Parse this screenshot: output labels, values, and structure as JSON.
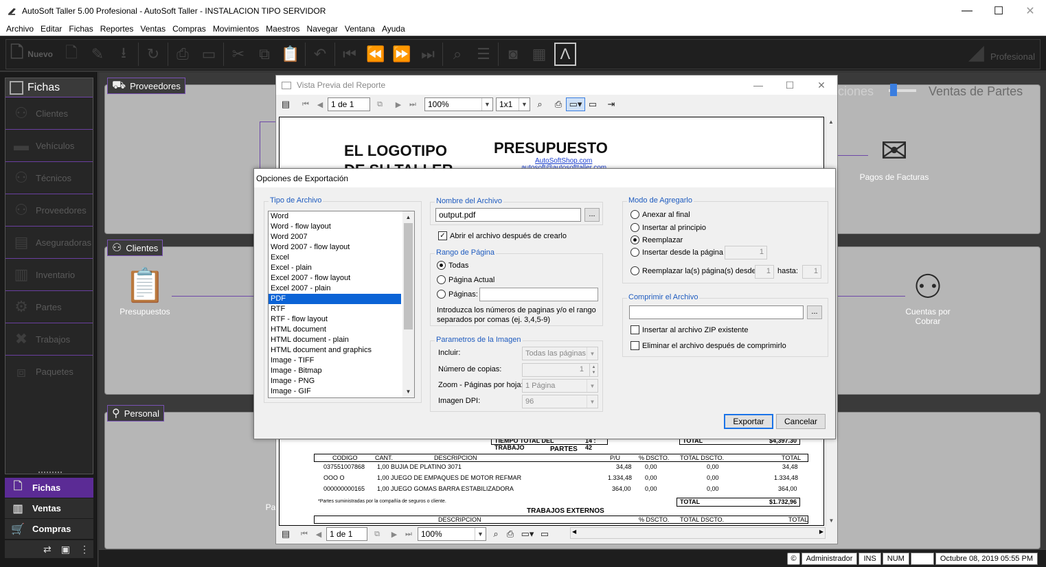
{
  "window": {
    "title": "AutoSoft Taller 5.00 Profesional - AutoSoft Taller - INSTALACION TIPO SERVIDOR",
    "minimize": "—",
    "maximize": "☐",
    "close": "✕"
  },
  "menu": [
    "Archivo",
    "Editar",
    "Fichas",
    "Reportes",
    "Ventas",
    "Compras",
    "Movimientos",
    "Maestros",
    "Navegar",
    "Ventana",
    "Ayuda"
  ],
  "toolbar": {
    "new_label": "Nuevo",
    "brand": "Profesional"
  },
  "sidebar": {
    "header": "Fichas",
    "items": [
      {
        "label": "Clientes",
        "icon": "people-icon"
      },
      {
        "label": "Vehículos",
        "icon": "car-icon"
      },
      {
        "label": "Técnicos",
        "icon": "people-icon"
      },
      {
        "label": "Proveedores",
        "icon": "people-icon"
      },
      {
        "label": "Aseguradoras",
        "icon": "id-card-icon"
      },
      {
        "label": "Inventario",
        "icon": "inventory-icon"
      },
      {
        "label": "Partes",
        "icon": "engine-icon"
      },
      {
        "label": "Trabajos",
        "icon": "tools-icon"
      },
      {
        "label": "Paquetes",
        "icon": "package-icon"
      }
    ],
    "nav": [
      {
        "label": "Fichas"
      },
      {
        "label": "Ventas"
      },
      {
        "label": "Compras"
      }
    ]
  },
  "workspace": {
    "sections": {
      "proveedores": "Proveedores",
      "clientes": "Clientes",
      "personal": "Personal"
    },
    "heading_left": "ciones",
    "heading_right": "Ventas de Partes",
    "modules": {
      "pagos": "Pagos de Facturas",
      "presupuestos": "Presupuestos",
      "cuentas": "Cuentas por Cobrar",
      "pa": "Pa"
    }
  },
  "preview": {
    "title": "Vista Previa del Reporte",
    "page_field": "1 de 1",
    "zoom": "100%",
    "layout": "1x1",
    "report": {
      "logo_line1": "EL LOGOTIPO",
      "logo_line2": "DE SU TALLER",
      "title": "PRESUPUESTO",
      "link1": "AutoSoftShop.com",
      "link2": "autosoft@autosofttaller.com",
      "tiempo_label": "TIEMPO TOTAL DEL TRABAJO",
      "tiempo_value": "14 : 42",
      "total_label": "TOTAL",
      "total_value": "$4,397.30",
      "partes_title": "PARTES",
      "columns": [
        "CODIGO",
        "CANT.",
        "DESCRIPCION",
        "P/U",
        "% DSCTO.",
        "TOTAL DSCTO.",
        "TOTAL"
      ],
      "rows": [
        {
          "codigo": "037551007868",
          "cant": "1,00",
          "desc": "BUJIA DE PLATINO 3071",
          "pu": "34,48",
          "dscto": "0,00",
          "tdscto": "0,00",
          "total": "34,48"
        },
        {
          "codigo": "OOO O",
          "cant": "1,00",
          "desc": "JUEGO DE EMPAQUES DE MOTOR REFMAR",
          "pu": "1.334,48",
          "dscto": "0,00",
          "tdscto": "0,00",
          "total": "1.334,48"
        },
        {
          "codigo": "000000000165",
          "cant": "1,00",
          "desc": "JUEGO GOMAS BARRA ESTABILIZADORA",
          "pu": "364,00",
          "dscto": "0,00",
          "tdscto": "0,00",
          "total": "364,00"
        }
      ],
      "parts_total_label": "TOTAL",
      "parts_total_value": "$1.732,96",
      "nota": "*Partes suministradas por la compañía de seguros o cliente.",
      "externos_title": "TRABAJOS EXTERNOS",
      "ext_columns": [
        "DESCRIPCION",
        "% DSCTO.",
        "TOTAL DSCTO.",
        "TOTAL"
      ]
    }
  },
  "dialog": {
    "title": "Opciones de Exportación",
    "tipo_label": "Tipo de Archivo",
    "file_types": [
      "Word",
      "Word - flow layout",
      "Word 2007",
      "Word 2007 - flow layout",
      "Excel",
      "Excel - plain",
      "Excel 2007 - flow layout",
      "Excel 2007 - plain",
      "PDF",
      "RTF",
      "RTF - flow layout",
      "HTML document",
      "HTML document - plain",
      "HTML document and graphics",
      "Image - TIFF",
      "Image - Bitmap",
      "Image - PNG",
      "Image - GIF"
    ],
    "selected_type": "PDF",
    "nombre_label": "Nombre del Archivo",
    "filename": "output.pdf",
    "browse": "...",
    "abrir_label": "Abrir el archivo después de crearlo",
    "rango_label": "Rango de Página",
    "todas": "Todas",
    "actual": "Página Actual",
    "paginas": "Páginas:",
    "help": "Introduzca los números de paginas y/o el rango separados por comas (ej. 3,4,5-9)",
    "imagen_label": "Parametros de la Imagen",
    "incluir_label": "Incluir:",
    "incluir_value": "Todas las páginas",
    "copias_label": "Número de copias:",
    "copias_value": "1",
    "zoom_label": "Zoom - Páginas por hoja:",
    "zoom_value": "1 Página",
    "dpi_label": "Imagen DPI:",
    "dpi_value": "96",
    "modo_label": "Modo de Agregarlo",
    "anexar": "Anexar al final",
    "insertar": "Insertar al principio",
    "reemplazar": "Reemplazar",
    "insertar_desde": "Insertar desde la página",
    "insertar_desde_value": "1",
    "reemplazar_desde": "Reemplazar la(s) página(s) desde:",
    "desde_value": "1",
    "hasta": "hasta:",
    "hasta_value": "1",
    "comprimir_label": "Comprimir el Archivo",
    "zip_label": "Insertar al archivo ZIP existente",
    "eliminar_label": "Eliminar el archivo después de comprimirlo",
    "exportar": "Exportar",
    "cancelar": "Cancelar"
  },
  "status": {
    "copyright": "©",
    "user": "Administrador",
    "ins": "INS",
    "num": "NUM",
    "datetime": "Octubre 08, 2019 05:55 PM"
  }
}
